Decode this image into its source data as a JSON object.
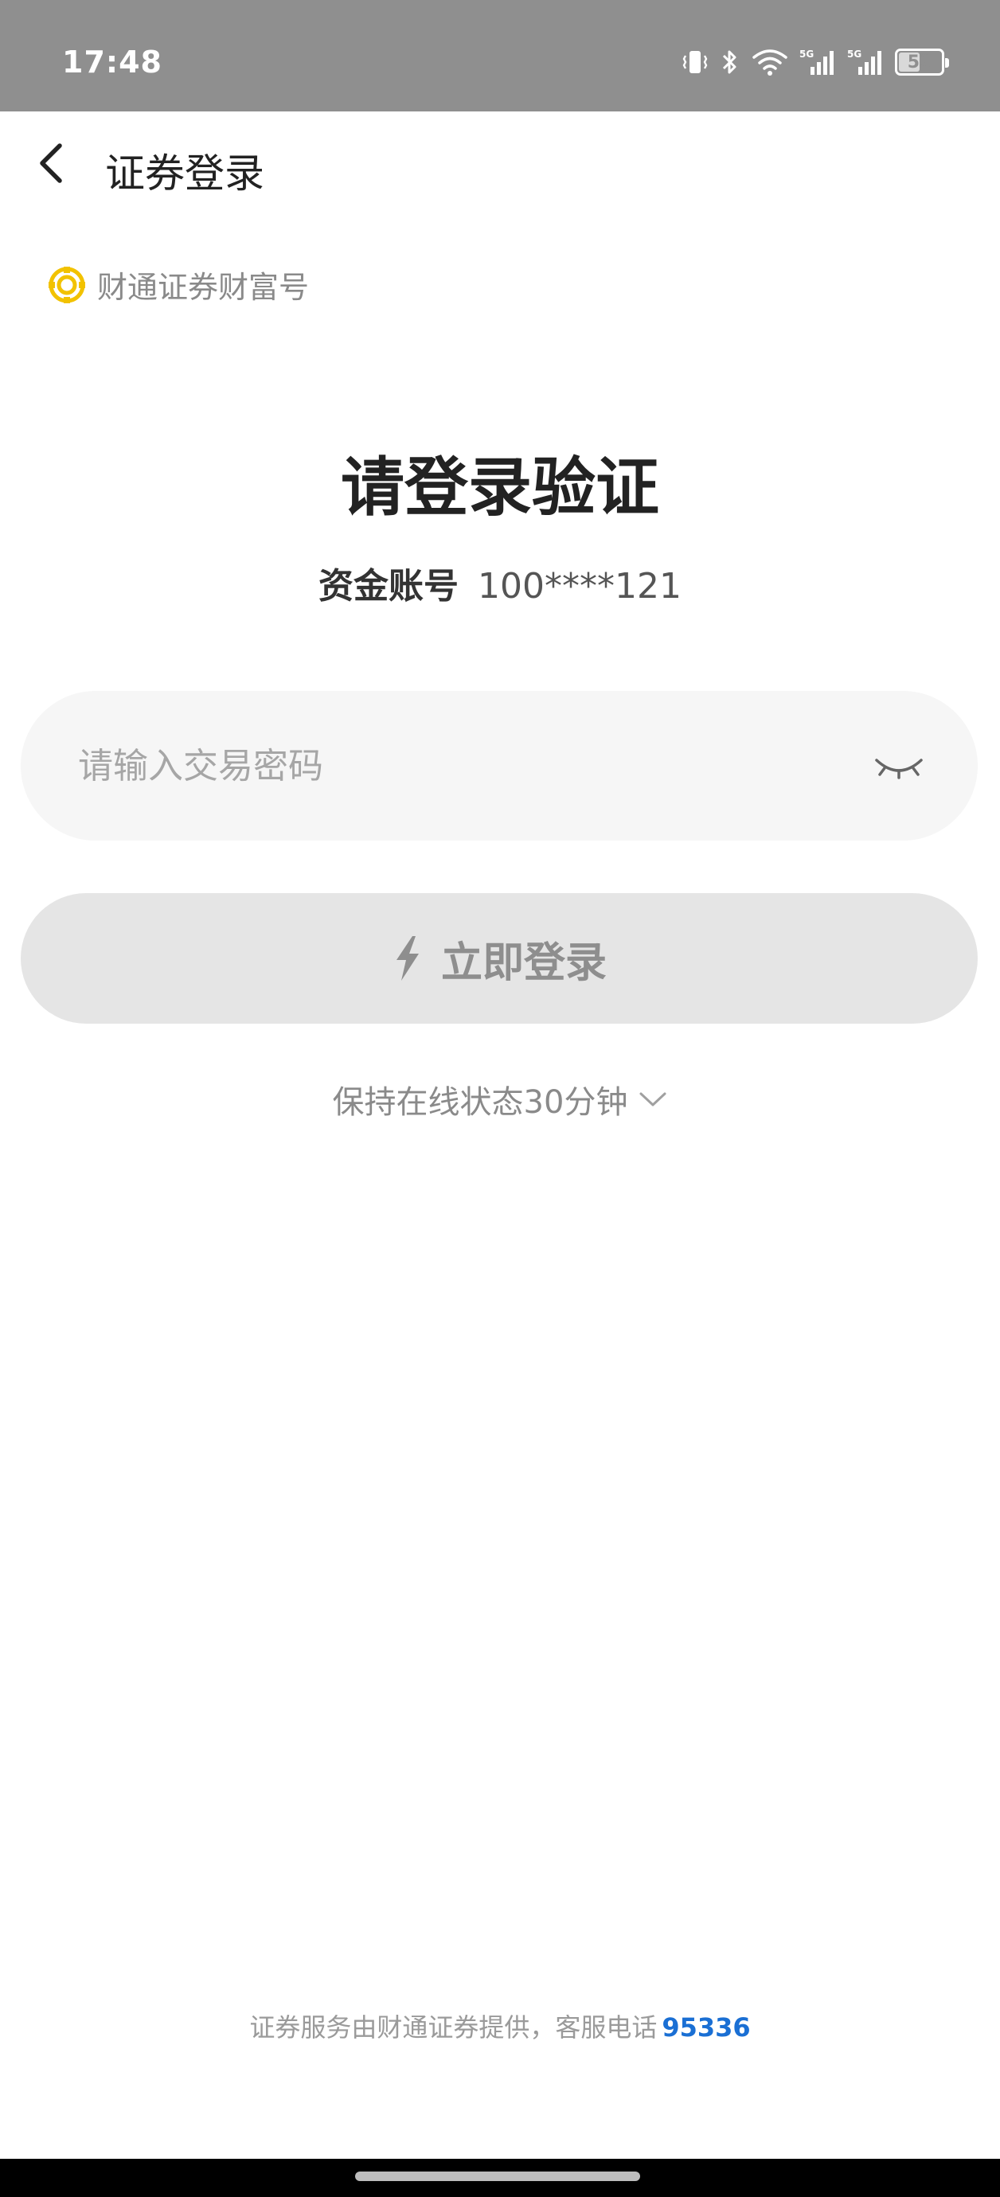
{
  "status_bar": {
    "time": "17:48",
    "battery_level": "53",
    "network_labels": [
      "5G",
      "5G"
    ],
    "icons": [
      "vibrate-icon",
      "bluetooth-icon",
      "wifi-icon",
      "signal-5g-icon",
      "signal-5g-icon",
      "battery-icon"
    ]
  },
  "nav": {
    "back_icon": "chevron-left-icon",
    "title": "证券登录"
  },
  "broker": {
    "logo_icon": "caitong-logo-icon",
    "name": "财通证券财富号",
    "logo_color": "#f2c200"
  },
  "login": {
    "title": "请登录验证",
    "account_label": "资金账号",
    "account_value": "100****121",
    "password_placeholder": "请输入交易密码",
    "password_value": "",
    "eye_icon": "eye-closed-icon",
    "button_label": "立即登录",
    "button_icon": "lightning-icon",
    "button_enabled": false,
    "keep_online_label": "保持在线状态30分钟",
    "keep_online_icon": "chevron-down-icon"
  },
  "footer": {
    "text": "证券服务由财通证券提供，客服电话",
    "phone": "95336",
    "phone_color": "#1a6fd4"
  },
  "colors": {
    "status_bar_bg": "#8f8f8f",
    "input_bg": "#f6f6f6",
    "button_bg_disabled": "#e5e5e5",
    "title_text": "#222222"
  }
}
